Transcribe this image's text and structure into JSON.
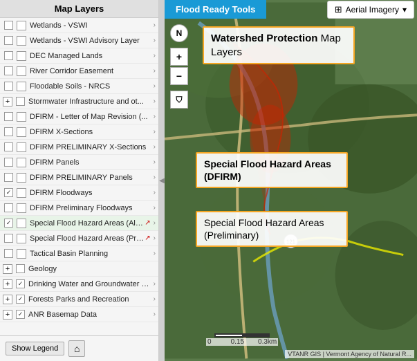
{
  "panel": {
    "header": "Map Layers",
    "layers": [
      {
        "id": "wetlands-vswi",
        "label": "Wetlands - VSWI",
        "checked": false,
        "expandable": false,
        "type": "leaf"
      },
      {
        "id": "wetlands-advisory",
        "label": "Wetlands - VSWI Advisory Layer",
        "checked": false,
        "expandable": true,
        "type": "leaf"
      },
      {
        "id": "dec-managed",
        "label": "DEC Managed Lands",
        "checked": false,
        "expandable": true,
        "type": "leaf"
      },
      {
        "id": "river-corridor",
        "label": "River Corridor Easement",
        "checked": false,
        "expandable": true,
        "type": "leaf"
      },
      {
        "id": "floodable-soils",
        "label": "Floodable Soils - NRCS",
        "checked": false,
        "expandable": true,
        "type": "leaf"
      },
      {
        "id": "stormwater",
        "label": "Stormwater Infrastructure and ot...",
        "checked": false,
        "expandable": true,
        "type": "group",
        "hasPlus": true
      },
      {
        "id": "dfirm-letter",
        "label": "DFIRM - Letter of Map Revision (...",
        "checked": false,
        "expandable": true,
        "type": "leaf"
      },
      {
        "id": "dfirm-xsections",
        "label": "DFIRM X-Sections",
        "checked": false,
        "expandable": true,
        "type": "leaf"
      },
      {
        "id": "dfirm-prelim-xsections",
        "label": "DFIRM PRELIMINARY X-Sections",
        "checked": false,
        "expandable": true,
        "type": "leaf"
      },
      {
        "id": "dfirm-panels",
        "label": "DFIRM Panels",
        "checked": false,
        "expandable": true,
        "type": "leaf"
      },
      {
        "id": "dfirm-prelim-panels",
        "label": "DFIRM PRELIMINARY Panels",
        "checked": false,
        "expandable": true,
        "type": "leaf"
      },
      {
        "id": "dfirm-floodways",
        "label": "DFIRM Floodways",
        "checked": true,
        "expandable": true,
        "type": "leaf"
      },
      {
        "id": "dfirm-prelim-floodways",
        "label": "DFIRM Preliminary Floodways",
        "checked": false,
        "expandable": true,
        "type": "leaf"
      },
      {
        "id": "special-flood-all",
        "label": "Special Flood Hazard Areas (All ...",
        "checked": true,
        "expandable": true,
        "type": "leaf",
        "arrow": true
      },
      {
        "id": "special-flood-prelim",
        "label": "Special Flood Hazard Areas (Preli...",
        "checked": false,
        "expandable": true,
        "type": "leaf",
        "arrow": true
      },
      {
        "id": "tactical-basin",
        "label": "Tactical Basin Planning",
        "checked": false,
        "expandable": true,
        "type": "leaf"
      }
    ],
    "groups": [
      {
        "id": "geology",
        "label": "Geology",
        "checked": false,
        "expanded": false
      },
      {
        "id": "drinking-water",
        "label": "Drinking Water and Groundwater Pr...",
        "checked": true,
        "expanded": false
      },
      {
        "id": "forests-parks",
        "label": "Forests Parks and Recreation",
        "checked": true,
        "expanded": false
      },
      {
        "id": "anr-basemap",
        "label": "ANR Basemap Data",
        "checked": true,
        "expanded": false
      }
    ],
    "footer": {
      "show_legend": "Show Legend"
    }
  },
  "toolbar": {
    "flood_ready": "Flood Ready Tools",
    "aerial_imagery": "Aerial Imagery"
  },
  "map": {
    "labels": {
      "watershed": "Watershed Protection",
      "watershed_suffix": " Map Layers",
      "dfirm": "Special Flood Hazard Areas (DFIRM)",
      "preliminary": "Special Flood Hazard Areas (Preliminary)"
    },
    "scale": {
      "label1": "0",
      "label2": "0.15",
      "label3": "0.3km"
    },
    "attribution": "VTANR GIS | Vermont Agency of Natural R..."
  }
}
